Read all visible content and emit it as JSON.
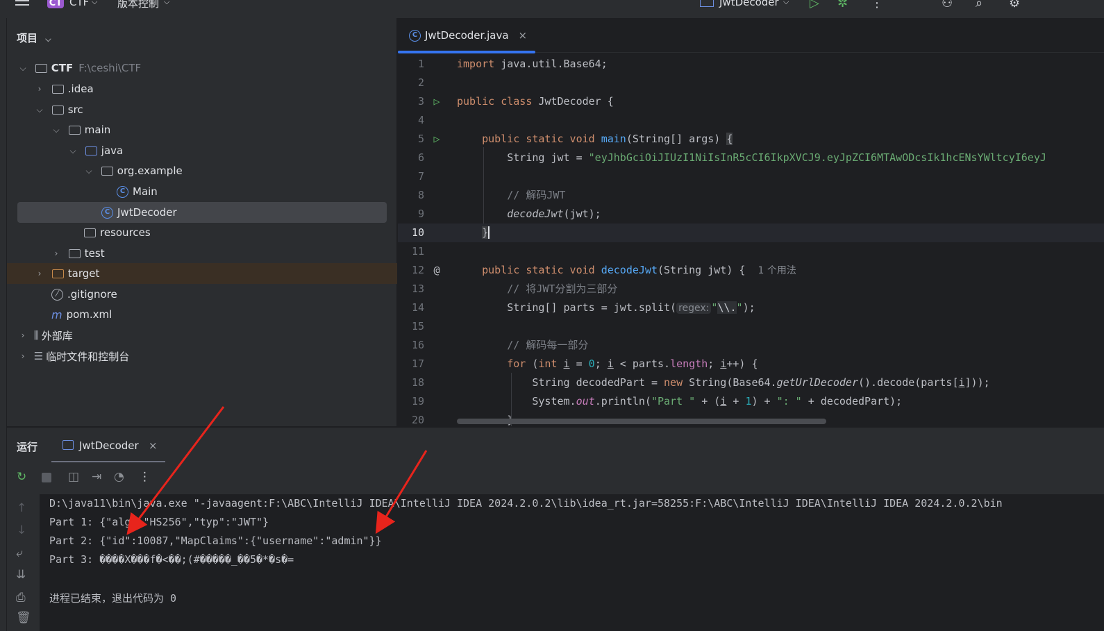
{
  "titlebar": {
    "project_badge": "CT",
    "project_name": "CTF",
    "vcs": "版本控制",
    "run_config": "JwtDecoder"
  },
  "project_panel": {
    "title": "项目",
    "tree": [
      {
        "label": "CTF",
        "path": "F:\\ceshi\\CTF"
      },
      {
        "label": ".idea"
      },
      {
        "label": "src"
      },
      {
        "label": "main"
      },
      {
        "label": "java"
      },
      {
        "label": "org.example"
      },
      {
        "label": "Main"
      },
      {
        "label": "JwtDecoder"
      },
      {
        "label": "resources"
      },
      {
        "label": "test"
      },
      {
        "label": "target"
      },
      {
        "label": ".gitignore"
      },
      {
        "label": "pom.xml"
      },
      {
        "label": "外部库"
      },
      {
        "label": "临时文件和控制台"
      }
    ]
  },
  "editor": {
    "tab": "JwtDecoder.java",
    "line_numbers": [
      "1",
      "2",
      "3",
      "4",
      "5",
      "6",
      "7",
      "8",
      "9",
      "10",
      "11",
      "12",
      "13",
      "14",
      "15",
      "16",
      "17",
      "18",
      "19",
      "20"
    ],
    "jwt_string": "\"eyJhbGciOiJIUzI1NiIsInR5cCI6IkpXVCJ9.eyJpZCI6MTAwODcsIk1hcENsYWltcyI6eyJ",
    "comment_decode": "// 解码JWT",
    "comment_split": "// 将JWT分割为三部分",
    "comment_each": "// 解码每一部分",
    "usage_hint": "1 个用法",
    "regex_hint": "regex:"
  },
  "run_panel": {
    "title": "运行",
    "tab": "JwtDecoder",
    "output": [
      "D:\\java11\\bin\\java.exe \"-javaagent:F:\\ABC\\IntelliJ IDEA\\IntelliJ IDEA 2024.2.0.2\\lib\\idea_rt.jar=58255:F:\\ABC\\IntelliJ IDEA\\IntelliJ IDEA 2024.2.0.2\\bin",
      "Part 1: {\"alg\":\"HS256\",\"typ\":\"JWT\"}",
      "Part 2: {\"id\":10087,\"MapClaims\":{\"username\":\"admin\"}}",
      "Part 3: ���\u0005�X���f�<��;(#�����_��5�*�s�=",
      "",
      "进程已结束，退出代码为 0"
    ]
  }
}
